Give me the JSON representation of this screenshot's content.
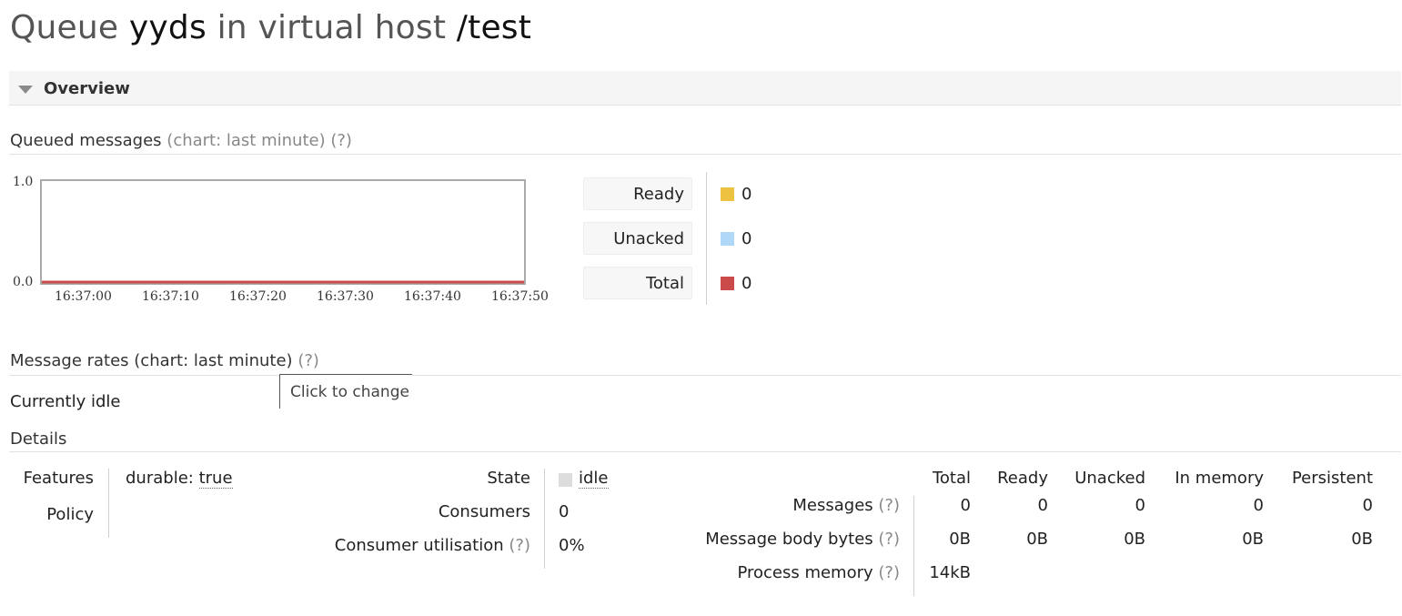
{
  "title": {
    "prefix": "Queue",
    "queue": "yyds",
    "middle": "in virtual host",
    "vhost": "/test"
  },
  "overview": {
    "label": "Overview"
  },
  "queued": {
    "label": "Queued messages",
    "chart_hint": "(chart: last minute)",
    "help": "(?)"
  },
  "chart_data": {
    "type": "line",
    "x": [
      "16:37:00",
      "16:37:10",
      "16:37:20",
      "16:37:30",
      "16:37:40",
      "16:37:50"
    ],
    "ylim": [
      0,
      1.0
    ],
    "yticks": [
      "1.0",
      "0.0"
    ],
    "series": [
      {
        "name": "Ready",
        "color": "#edc240",
        "values": [
          0,
          0,
          0,
          0,
          0,
          0
        ]
      },
      {
        "name": "Unacked",
        "color": "#afd8f8",
        "values": [
          0,
          0,
          0,
          0,
          0,
          0
        ]
      },
      {
        "name": "Total",
        "color": "#cb4b4b",
        "values": [
          0,
          0,
          0,
          0,
          0,
          0
        ]
      }
    ]
  },
  "legend": [
    {
      "label": "Ready",
      "value": "0",
      "color": "#edc240"
    },
    {
      "label": "Unacked",
      "value": "0",
      "color": "#afd8f8"
    },
    {
      "label": "Total",
      "value": "0",
      "color": "#cb4b4b"
    }
  ],
  "rates": {
    "label": "Message rates (chart: last minute)",
    "help": "(?)",
    "tooltip": "Click to change",
    "idle": "Currently idle"
  },
  "details": {
    "label": "Details",
    "features_label": "Features",
    "features_key": "durable:",
    "features_value": "true",
    "policy_label": "Policy",
    "state_label": "State",
    "state_value": "idle",
    "consumers_label": "Consumers",
    "consumers_value": "0",
    "utilisation_label": "Consumer utilisation",
    "utilisation_value": "0%",
    "help": "(?)"
  },
  "stats": {
    "columns": [
      "Total",
      "Ready",
      "Unacked",
      "In memory",
      "Persistent"
    ],
    "rows": [
      {
        "label": "Messages",
        "values": [
          "0",
          "0",
          "0",
          "0",
          "0"
        ]
      },
      {
        "label": "Message body bytes",
        "values": [
          "0B",
          "0B",
          "0B",
          "0B",
          "0B"
        ]
      },
      {
        "label": "Process memory",
        "values": [
          "14kB"
        ]
      }
    ]
  }
}
